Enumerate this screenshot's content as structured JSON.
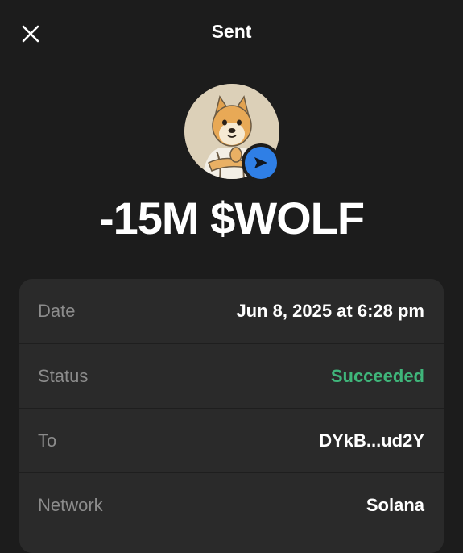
{
  "header": {
    "title": "Sent",
    "close_icon": "close-icon"
  },
  "token": {
    "avatar_icon": "doge-avatar-icon",
    "badge_icon": "paper-plane-icon",
    "amount": "-15M $WOLF"
  },
  "details": {
    "rows": [
      {
        "label": "Date",
        "value": "Jun 8, 2025 at 6:28 pm"
      },
      {
        "label": "Status",
        "value": "Succeeded"
      },
      {
        "label": "To",
        "value": "DYkB...ud2Y"
      },
      {
        "label": "Network",
        "value": "Solana"
      }
    ]
  },
  "colors": {
    "background": "#1c1c1c",
    "card": "#2a2a2a",
    "label": "#8c8c8c",
    "success": "#3fb57a",
    "badge": "#2f7fe6"
  }
}
